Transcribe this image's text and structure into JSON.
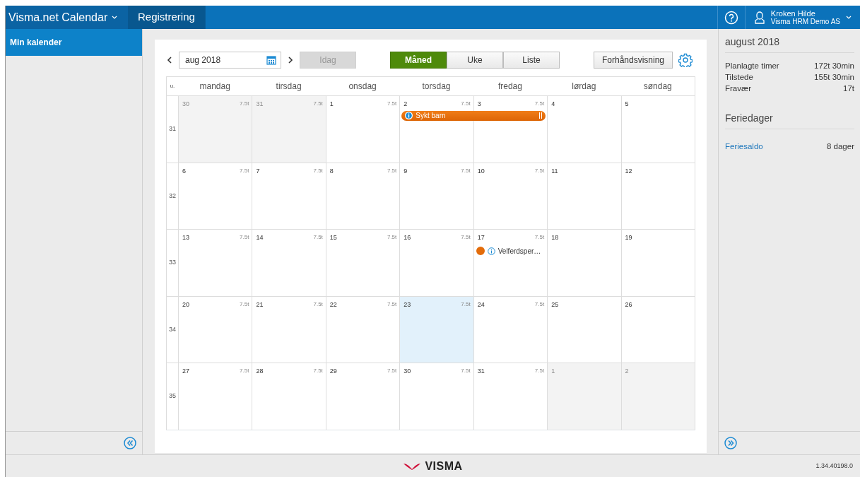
{
  "app": {
    "title": "Visma.net Calendar",
    "tabs": [
      {
        "label": "Registrering",
        "selected": true
      }
    ]
  },
  "user": {
    "name": "Kroken Hilde",
    "company": "Visma HRM Demo AS"
  },
  "sidebar": {
    "items": [
      {
        "label": "Min kalender",
        "selected": true
      }
    ]
  },
  "toolbar": {
    "date": "aug 2018",
    "today": {
      "label": "Idag",
      "disabled": true
    },
    "views": [
      {
        "label": "Måned",
        "selected": true
      },
      {
        "label": "Uke",
        "selected": false
      },
      {
        "label": "Liste",
        "selected": false
      }
    ],
    "preview": "Forhåndsvisning"
  },
  "calendar": {
    "week_header": "u.",
    "days": [
      "mandag",
      "tirsdag",
      "onsdag",
      "torsdag",
      "fredag",
      "lørdag",
      "søndag"
    ],
    "weeks": [
      {
        "number": "31",
        "days": [
          {
            "date": "30",
            "hours": "7.5t",
            "outside": true,
            "today": false
          },
          {
            "date": "31",
            "hours": "7.5t",
            "outside": true,
            "today": false
          },
          {
            "date": "1",
            "hours": "7.5t",
            "outside": false,
            "today": false
          },
          {
            "date": "2",
            "hours": "7.5t",
            "outside": false,
            "today": false,
            "events": [
              {
                "kind": "bar",
                "label": "Sykt barn"
              }
            ]
          },
          {
            "date": "3",
            "hours": "7.5t",
            "outside": false,
            "today": false,
            "events": [
              {
                "kind": "bar-continue"
              }
            ]
          },
          {
            "date": "4",
            "outside": false,
            "today": false
          },
          {
            "date": "5",
            "outside": false,
            "today": false
          }
        ]
      },
      {
        "number": "32",
        "days": [
          {
            "date": "6",
            "hours": "7.5t",
            "outside": false,
            "today": false
          },
          {
            "date": "7",
            "hours": "7.5t",
            "outside": false,
            "today": false
          },
          {
            "date": "8",
            "hours": "7.5t",
            "outside": false,
            "today": false
          },
          {
            "date": "9",
            "hours": "7.5t",
            "outside": false,
            "today": false
          },
          {
            "date": "10",
            "hours": "7.5t",
            "outside": false,
            "today": false
          },
          {
            "date": "11",
            "outside": false,
            "today": false
          },
          {
            "date": "12",
            "outside": false,
            "today": false
          }
        ]
      },
      {
        "number": "33",
        "days": [
          {
            "date": "13",
            "hours": "7.5t",
            "outside": false,
            "today": false
          },
          {
            "date": "14",
            "hours": "7.5t",
            "outside": false,
            "today": false
          },
          {
            "date": "15",
            "hours": "7.5t",
            "outside": false,
            "today": false
          },
          {
            "date": "16",
            "hours": "7.5t",
            "outside": false,
            "today": false
          },
          {
            "date": "17",
            "hours": "7.5t",
            "outside": false,
            "today": false,
            "events": [
              {
                "kind": "dot",
                "label": "Velferdsper…",
                "color": "#e36c0a"
              }
            ]
          },
          {
            "date": "18",
            "outside": false,
            "today": false
          },
          {
            "date": "19",
            "outside": false,
            "today": false
          }
        ]
      },
      {
        "number": "34",
        "days": [
          {
            "date": "20",
            "hours": "7.5t",
            "outside": false,
            "today": false
          },
          {
            "date": "21",
            "hours": "7.5t",
            "outside": false,
            "today": false
          },
          {
            "date": "22",
            "hours": "7.5t",
            "outside": false,
            "today": false
          },
          {
            "date": "23",
            "hours": "7.5t",
            "outside": false,
            "today": true
          },
          {
            "date": "24",
            "hours": "7.5t",
            "outside": false,
            "today": false
          },
          {
            "date": "25",
            "outside": false,
            "today": false
          },
          {
            "date": "26",
            "outside": false,
            "today": false
          }
        ]
      },
      {
        "number": "35",
        "days": [
          {
            "date": "27",
            "hours": "7.5t",
            "outside": false,
            "today": false
          },
          {
            "date": "28",
            "hours": "7.5t",
            "outside": false,
            "today": false
          },
          {
            "date": "29",
            "hours": "7.5t",
            "outside": false,
            "today": false
          },
          {
            "date": "30",
            "hours": "7.5t",
            "outside": false,
            "today": false
          },
          {
            "date": "31",
            "hours": "7.5t",
            "outside": false,
            "today": false
          },
          {
            "date": "1",
            "outside": true,
            "today": false
          },
          {
            "date": "2",
            "outside": true,
            "today": false
          }
        ]
      }
    ]
  },
  "summary": {
    "title": "august 2018",
    "rows": [
      {
        "label": "Planlagte timer",
        "value": "172t 30min"
      },
      {
        "label": "Tilstede",
        "value": "155t 30min"
      },
      {
        "label": "Fravær",
        "value": "17t"
      }
    ],
    "vacation_title": "Feriedager",
    "vacation": {
      "link": "Feriesaldo",
      "value": "8 dager"
    }
  },
  "footer": {
    "logo": "VISMA",
    "version": "1.34.40198.0"
  }
}
